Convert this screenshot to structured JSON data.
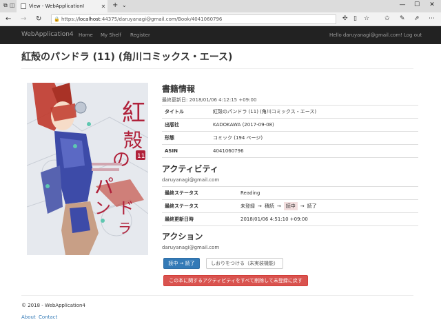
{
  "browser": {
    "tab_title": "View - WebApplicationI",
    "tab_close": "✕",
    "new_tab": "+",
    "tab_list": "⌄",
    "url_prefix": "https://",
    "url_host": "localhost",
    "url_rest": ":44375/daruyanagi@gmail.com/Book/4041060796",
    "back": "←",
    "forward": "→",
    "refresh": "↻",
    "minimize": "—",
    "maximize": "☐",
    "close": "✕"
  },
  "navbar": {
    "brand": "WebApplication4",
    "links": [
      "Home",
      "My Shelf",
      "Register"
    ],
    "user": "Hello daruyanagi@gmail.com!",
    "logout": "Log out"
  },
  "book": {
    "title": "紅殻のパンドラ (11) (角川コミックス・エース)",
    "cover_title": "紅殻のパンドラ",
    "cover_volume": "11"
  },
  "info": {
    "heading": "書籍情報",
    "updated": "最終更新日: 2018/01/06 4:12:15 +09:00",
    "rows": [
      {
        "key": "タイトル",
        "value": "紅殻のパンドラ (11) (角川コミックス・エース)"
      },
      {
        "key": "出版社",
        "value": "KADOKAWA (2017-09-08)"
      },
      {
        "key": "形態",
        "value": "コミック (194 ページ)"
      },
      {
        "key": "ASIN",
        "value": "4041060796"
      }
    ]
  },
  "activity": {
    "heading": "アクティビティ",
    "user": "daruyanagi@gmail.com",
    "status_label": "最終ステータス",
    "status_value": "Reading",
    "flow_label": "最終ステータス",
    "flow": [
      "未登録",
      "積読",
      "読中",
      "読了"
    ],
    "flow_arrow": "→",
    "flow_current": 2,
    "updated_label": "最終更新日時",
    "updated_value": "2018/01/06 4:51:10 +09:00"
  },
  "actions": {
    "heading": "アクション",
    "user": "daruyanagi@gmail.com",
    "primary": "読中 → 読了",
    "bookmark": "しおりをつける（未実装機能）",
    "reset": "この本に関するアクティビティをすべて削除して未登録に戻す"
  },
  "footer": {
    "copyright": "© 2018 - WebApplication4",
    "links": [
      "About",
      "Contact"
    ]
  },
  "colors": {
    "navbar": "#222222",
    "primary": "#337ab7",
    "danger": "#d9534f",
    "current_status": "#f2dede"
  }
}
